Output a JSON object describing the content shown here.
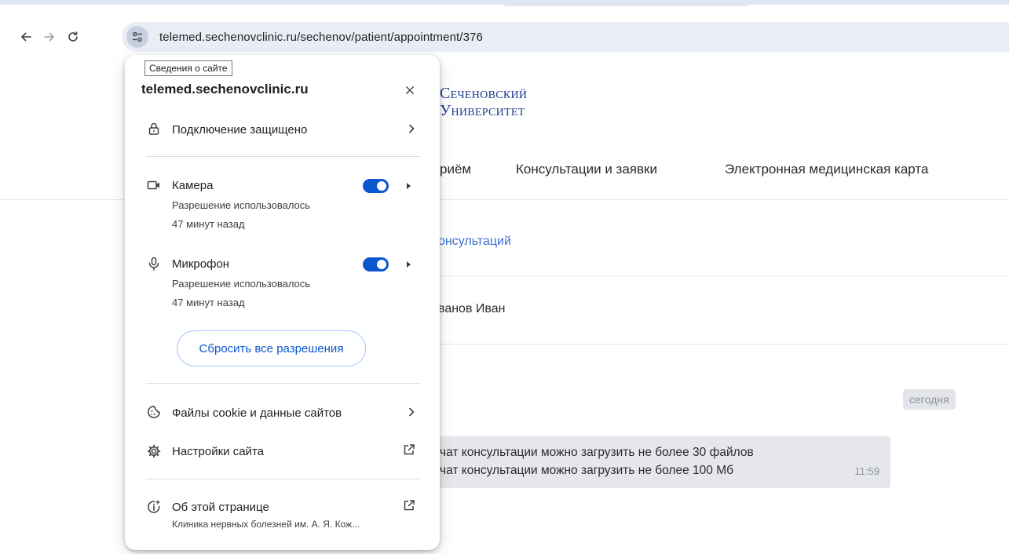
{
  "browser": {
    "url": "telemed.sechenovclinic.ru/sechenov/patient/appointment/376"
  },
  "page": {
    "logo_line1": "Сеченовский",
    "logo_line2": "Университет",
    "nav": {
      "priem": "риём",
      "consultations": "Консультации и заявки",
      "emk": "Электронная медицинская карта"
    },
    "breadcrumb": "онсультаций",
    "patient_name": "ванов Иван",
    "date_badge": "сегодня",
    "message": {
      "line1": "чат консультации можно загрузить не более 30 файлов",
      "line2": "чат консультации можно загрузить не более 100 Мб",
      "time": "11:59"
    }
  },
  "popup": {
    "tooltip": "Сведения о сайте",
    "title": "telemed.sechenovclinic.ru",
    "connection": "Подключение защищено",
    "camera": {
      "label": "Камера",
      "sub1": "Разрешение использовалось",
      "sub2": "47 минут назад",
      "enabled": true
    },
    "microphone": {
      "label": "Микрофон",
      "sub1": "Разрешение использовалось",
      "sub2": "47 минут назад",
      "enabled": true
    },
    "reset_button": "Сбросить все разрешения",
    "cookies": "Файлы cookie и данные сайтов",
    "site_settings": "Настройки сайта",
    "about_page": "Об этой странице",
    "about_sub": "Клиника нервных болезней им. А. Я. Кож...",
    "accent_color": "#0b57d0"
  }
}
